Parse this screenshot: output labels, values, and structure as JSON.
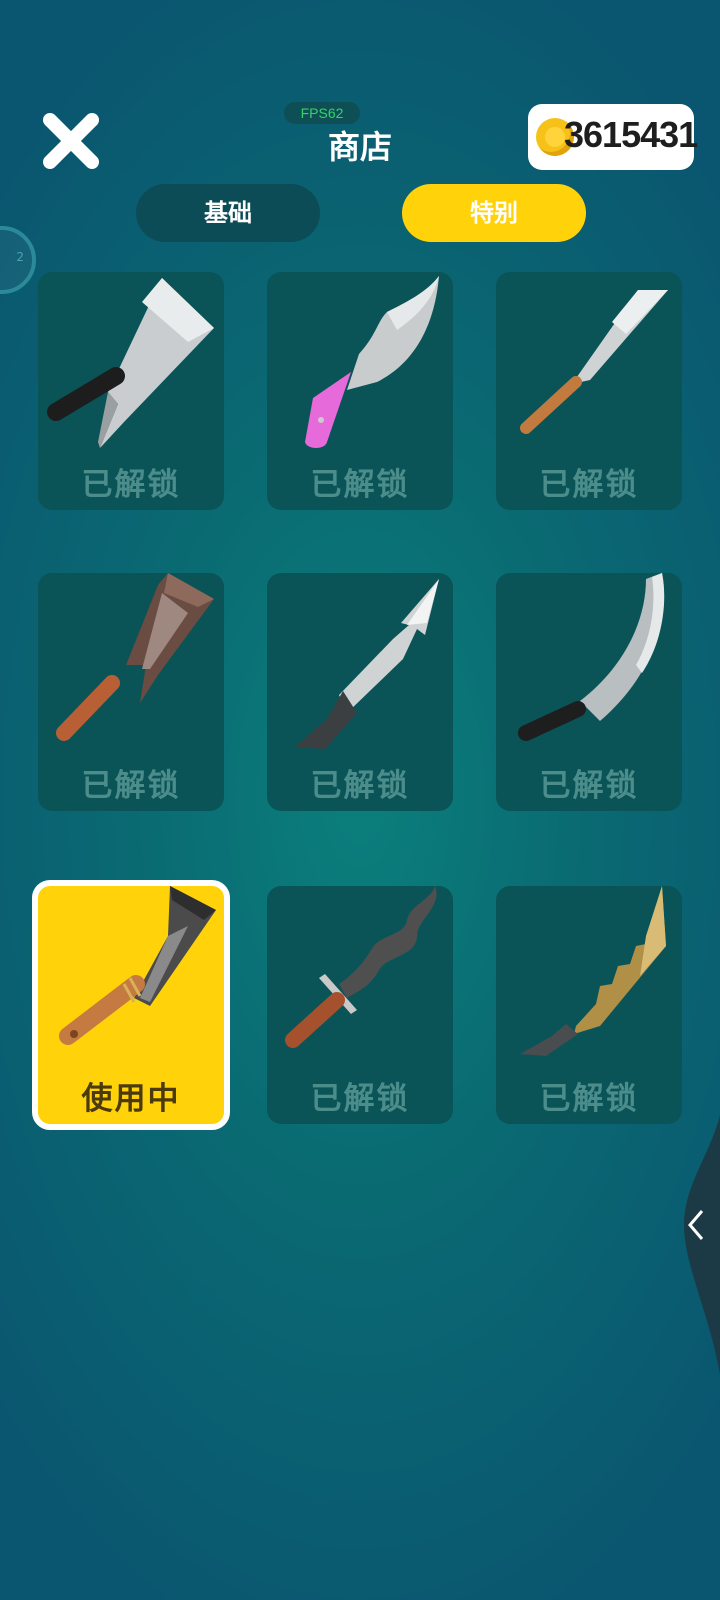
{
  "header": {
    "fps": "FPS62",
    "title": "商店",
    "coins": "3615431",
    "side_badge": "2"
  },
  "tabs": [
    {
      "label": "基础",
      "active": false
    },
    {
      "label": "特别",
      "active": true
    }
  ],
  "items": [
    {
      "status": "已解锁",
      "weapon": "cleaver-black-handle"
    },
    {
      "status": "已解锁",
      "weapon": "pink-handle-knife"
    },
    {
      "status": "已解锁",
      "weapon": "thin-chef-knife"
    },
    {
      "status": "已解锁",
      "weapon": "rusty-cleaver"
    },
    {
      "status": "已解锁",
      "weapon": "harpoon-blade"
    },
    {
      "status": "已解锁",
      "weapon": "curved-sword"
    },
    {
      "status": "使用中",
      "weapon": "dark-machete",
      "selected": true
    },
    {
      "status": "已解锁",
      "weapon": "wavy-dagger"
    },
    {
      "status": "已解锁",
      "weapon": "golden-serrated-blade"
    }
  ],
  "colors": {
    "accent": "#ffd20a",
    "card": "#0a5458",
    "background": "#0a6a72",
    "locked_text": "#4c8d8c"
  }
}
